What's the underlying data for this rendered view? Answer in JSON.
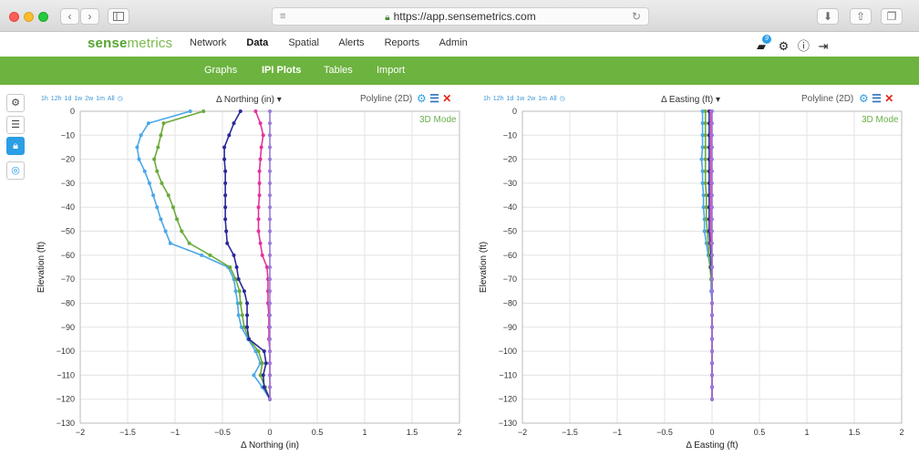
{
  "browser": {
    "url": "https://app.sensemetrics.com",
    "back_glyph": "‹",
    "forward_glyph": "›"
  },
  "app": {
    "logo_part1": "sense",
    "logo_part2": "metrics",
    "nav": [
      "Network",
      "Data",
      "Spatial",
      "Alerts",
      "Reports",
      "Admin"
    ],
    "active_nav": "Data",
    "notification_count": "9",
    "subnav": [
      "Graphs",
      "IPI Plots",
      "Tables",
      "Import"
    ],
    "active_subnav": "IPI Plots"
  },
  "colors": {
    "brand_green": "#6db33f",
    "accent_blue": "#2b9ee5",
    "close_red": "#e0251b"
  },
  "panels": [
    {
      "time_buttons": [
        "1h",
        "12h",
        "1d",
        "1w",
        "2w",
        "1m",
        "All"
      ],
      "measurement": "Δ Northing (in)",
      "plot_type": "Polyline (2D)",
      "mode_link": "3D Mode"
    },
    {
      "time_buttons": [
        "1h",
        "12h",
        "1d",
        "1w",
        "2w",
        "1m",
        "All"
      ],
      "measurement": "Δ Easting (ft)",
      "plot_type": "Polyline (2D)",
      "mode_link": "3D Mode"
    }
  ],
  "chart_data": [
    {
      "type": "line",
      "xlabel": "Δ Northing (in)",
      "ylabel": "Elevation (ft)",
      "xlim": [
        -2,
        2
      ],
      "ylim": [
        -130,
        0
      ],
      "xticks": [
        -2,
        -1.5,
        -1,
        -0.5,
        0,
        0.5,
        1,
        1.5,
        2
      ],
      "yticks": [
        0,
        -10,
        -20,
        -30,
        -40,
        -50,
        -60,
        -70,
        -80,
        -90,
        -100,
        -110,
        -120,
        -130
      ],
      "grid": true,
      "y": [
        0,
        -5,
        -10,
        -15,
        -20,
        -25,
        -30,
        -35,
        -40,
        -45,
        -50,
        -55,
        -60,
        -65,
        -70,
        -75,
        -80,
        -85,
        -90,
        -95,
        -100,
        -105,
        -110,
        -115,
        -120
      ],
      "series": [
        {
          "color": "#4aa8e8",
          "values": [
            -0.84,
            -1.28,
            -1.36,
            -1.4,
            -1.38,
            -1.32,
            -1.27,
            -1.23,
            -1.19,
            -1.15,
            -1.1,
            -1.05,
            -0.72,
            -0.44,
            -0.38,
            -0.36,
            -0.34,
            -0.33,
            -0.3,
            -0.23,
            -0.15,
            -0.1,
            -0.17,
            -0.08,
            0.0
          ]
        },
        {
          "color": "#6aaa3a",
          "values": [
            -0.7,
            -1.12,
            -1.15,
            -1.18,
            -1.22,
            -1.19,
            -1.14,
            -1.07,
            -1.02,
            -0.98,
            -0.93,
            -0.85,
            -0.63,
            -0.42,
            -0.36,
            -0.32,
            -0.31,
            -0.29,
            -0.27,
            -0.22,
            -0.12,
            -0.08,
            -0.1,
            -0.05,
            0.0
          ]
        },
        {
          "color": "#2a2a9a",
          "values": [
            -0.31,
            -0.38,
            -0.43,
            -0.48,
            -0.48,
            -0.47,
            -0.47,
            -0.47,
            -0.47,
            -0.47,
            -0.46,
            -0.45,
            -0.38,
            -0.35,
            -0.33,
            -0.27,
            -0.24,
            -0.24,
            -0.24,
            -0.22,
            -0.06,
            -0.04,
            -0.07,
            -0.06,
            0.0
          ]
        },
        {
          "color": "#e2339a",
          "values": [
            -0.15,
            -0.1,
            -0.07,
            -0.09,
            -0.1,
            -0.11,
            -0.11,
            -0.11,
            -0.12,
            -0.12,
            -0.12,
            -0.1,
            -0.08,
            -0.03,
            -0.02,
            -0.02,
            -0.02,
            -0.01,
            -0.01,
            -0.01,
            0.0,
            0.0,
            0.0,
            0.0,
            0.0
          ]
        },
        {
          "color": "#9a7ad8",
          "values": [
            0.0,
            0.0,
            0.0,
            0.0,
            0.0,
            0.0,
            0.0,
            0.0,
            0.0,
            0.0,
            0.0,
            0.0,
            0.0,
            0.0,
            0.0,
            0.0,
            0.0,
            0.0,
            0.0,
            0.0,
            0.0,
            0.0,
            0.0,
            0.0,
            0.0
          ]
        }
      ]
    },
    {
      "type": "line",
      "xlabel": "Δ Easting (ft)",
      "ylabel": "Elevation (ft)",
      "xlim": [
        -2,
        2
      ],
      "ylim": [
        -130,
        0
      ],
      "xticks": [
        -2,
        -1.5,
        -1,
        -0.5,
        0,
        0.5,
        1,
        1.5,
        2
      ],
      "yticks": [
        0,
        -10,
        -20,
        -30,
        -40,
        -50,
        -60,
        -70,
        -80,
        -90,
        -100,
        -110,
        -120,
        -130
      ],
      "grid": true,
      "y": [
        0,
        -5,
        -10,
        -15,
        -20,
        -25,
        -30,
        -35,
        -40,
        -45,
        -50,
        -55,
        -60,
        -65,
        -70,
        -75,
        -80,
        -85,
        -90,
        -95,
        -100,
        -105,
        -110,
        -115,
        -120
      ],
      "series": [
        {
          "color": "#4aa8e8",
          "values": [
            -0.1,
            -0.1,
            -0.1,
            -0.1,
            -0.11,
            -0.1,
            -0.1,
            -0.09,
            -0.09,
            -0.08,
            -0.08,
            -0.06,
            -0.04,
            -0.02,
            -0.01,
            -0.01,
            0.0,
            0.0,
            0.0,
            0.0,
            0.0,
            0.0,
            0.0,
            0.0,
            0.0
          ]
        },
        {
          "color": "#6aaa3a",
          "values": [
            -0.07,
            -0.07,
            -0.07,
            -0.07,
            -0.07,
            -0.07,
            -0.07,
            -0.06,
            -0.06,
            -0.06,
            -0.05,
            -0.04,
            -0.03,
            -0.02,
            -0.01,
            0.0,
            0.0,
            0.0,
            0.0,
            0.0,
            0.0,
            0.0,
            0.0,
            0.0,
            0.0
          ]
        },
        {
          "color": "#2a2a9a",
          "values": [
            -0.03,
            -0.03,
            -0.03,
            -0.03,
            -0.03,
            -0.03,
            -0.03,
            -0.03,
            -0.03,
            -0.03,
            -0.03,
            -0.02,
            -0.01,
            -0.01,
            0.0,
            0.0,
            0.0,
            0.0,
            0.0,
            0.0,
            0.0,
            0.0,
            0.0,
            0.0,
            0.0
          ]
        },
        {
          "color": "#e2339a",
          "values": [
            -0.01,
            -0.01,
            -0.01,
            -0.01,
            -0.01,
            -0.01,
            -0.01,
            -0.01,
            -0.01,
            -0.01,
            -0.01,
            -0.01,
            0.0,
            0.0,
            0.0,
            0.0,
            0.0,
            0.0,
            0.0,
            0.0,
            0.0,
            0.0,
            0.0,
            0.0,
            0.0
          ]
        },
        {
          "color": "#9a7ad8",
          "values": [
            0.0,
            0.0,
            0.0,
            0.0,
            0.0,
            0.0,
            0.0,
            0.0,
            0.0,
            0.0,
            0.0,
            0.0,
            0.0,
            0.0,
            0.0,
            0.0,
            0.0,
            0.0,
            0.0,
            0.0,
            0.0,
            0.0,
            0.0,
            0.0,
            0.0
          ]
        }
      ]
    }
  ]
}
